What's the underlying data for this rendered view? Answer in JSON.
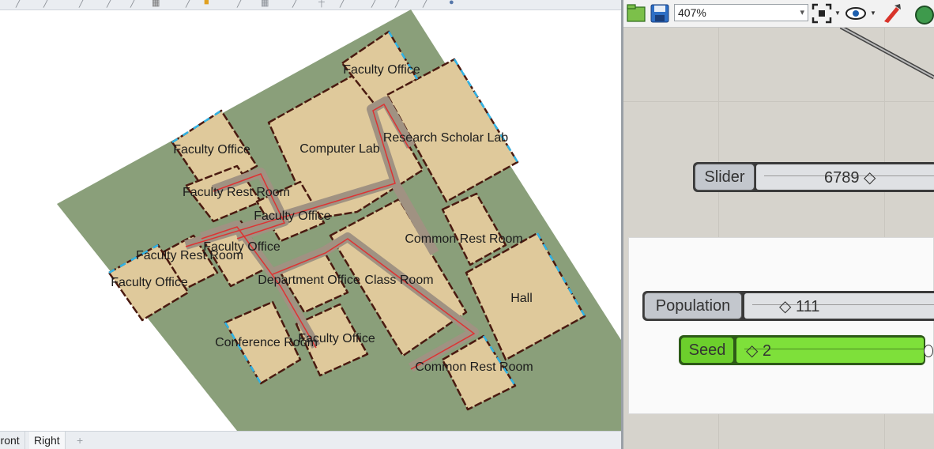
{
  "viewport": {
    "rooms": [
      {
        "label": "Faculty Office"
      },
      {
        "label": "Computer Lab"
      },
      {
        "label": "Research Scholar Lab"
      },
      {
        "label": "Faculty Office"
      },
      {
        "label": "Faculty Rest Room"
      },
      {
        "label": "Faculty Office"
      },
      {
        "label": "Faculty Office"
      },
      {
        "label": "Faculty Rest Room"
      },
      {
        "label": "Faculty Office"
      },
      {
        "label": "Common Rest Room"
      },
      {
        "label": "Department Office"
      },
      {
        "label": "Class Room"
      },
      {
        "label": "Hall"
      },
      {
        "label": "Conference Room"
      },
      {
        "label": "Faculty Office"
      },
      {
        "label": "Common Rest Room"
      }
    ],
    "tabs": [
      "Front",
      "Right"
    ],
    "add_tab_icon": "plus-icon"
  },
  "canvas": {
    "toolbar": {
      "zoom": "407%",
      "icons": [
        "open-file-icon",
        "save-icon",
        "zoom-extents-icon",
        "preview-eye-icon",
        "sketch-brush-icon",
        "display-icon"
      ]
    },
    "components": {
      "slider": {
        "label": "Slider",
        "value": "6789 ◇"
      },
      "population": {
        "label": "Population",
        "value": "◇ 111"
      },
      "seed": {
        "label": "Seed",
        "value": "◇ 2"
      }
    },
    "colors": {
      "seed_green": "#6ccf2c",
      "slider_gray": "#c3c7cd",
      "ground": "#8a9f7a",
      "room_fill": "#dfc99b",
      "corridor": "#a09282"
    }
  }
}
